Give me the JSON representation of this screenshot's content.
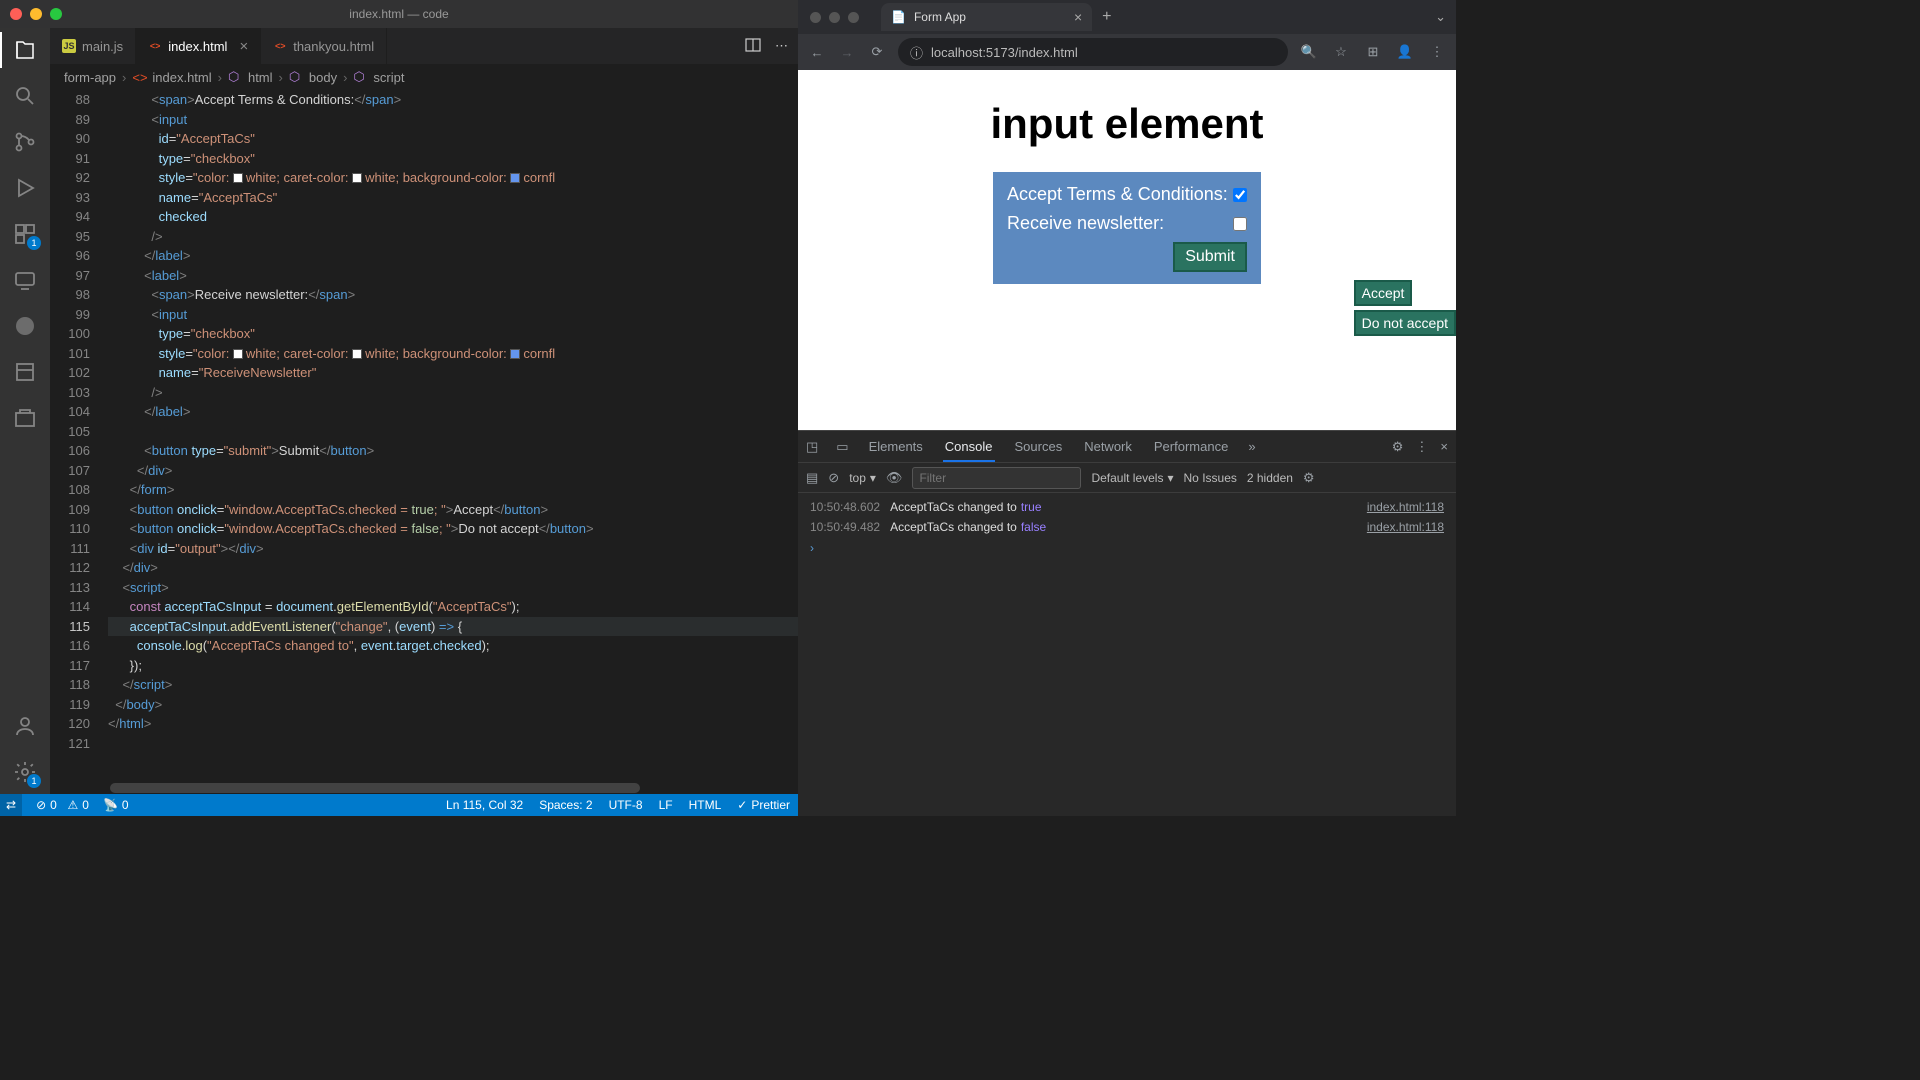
{
  "vscode": {
    "title": "index.html — code",
    "tabs": [
      {
        "icon": "js",
        "label": "main.js",
        "active": false,
        "close": false
      },
      {
        "icon": "html",
        "label": "index.html",
        "active": true,
        "close": true
      },
      {
        "icon": "html",
        "label": "thankyou.html",
        "active": false,
        "close": false
      }
    ],
    "breadcrumb": [
      "form-app",
      "index.html",
      "html",
      "body",
      "script"
    ],
    "activity_badges": {
      "ext": "1",
      "gear": "1"
    },
    "line_start": 88,
    "current_line": 115,
    "statusbar": {
      "errors": "0",
      "warnings": "0",
      "ports": "0",
      "cursor": "Ln 115, Col 32",
      "spaces": "Spaces: 2",
      "encoding": "UTF-8",
      "eol": "LF",
      "lang": "HTML",
      "formatter": "Prettier"
    }
  },
  "browser": {
    "tab_title": "Form App",
    "url": "localhost:5173/index.html",
    "page": {
      "heading": "input element",
      "row1": "Accept Terms & Conditions:",
      "row2": "Receive newsletter:",
      "submit": "Submit",
      "accept": "Accept",
      "dontaccept": "Do not accept"
    },
    "devtools": {
      "tabs": [
        "Elements",
        "Console",
        "Sources",
        "Network",
        "Performance"
      ],
      "active_tab": "Console",
      "context": "top",
      "levels": "Default levels",
      "issues": "No Issues",
      "hidden": "2 hidden",
      "filter_placeholder": "Filter",
      "logs": [
        {
          "ts": "10:50:48.602",
          "msg": "AcceptTaCs changed to",
          "val": "true",
          "src": "index.html:118"
        },
        {
          "ts": "10:50:49.482",
          "msg": "AcceptTaCs changed to",
          "val": "false",
          "src": "index.html:118"
        }
      ]
    }
  }
}
